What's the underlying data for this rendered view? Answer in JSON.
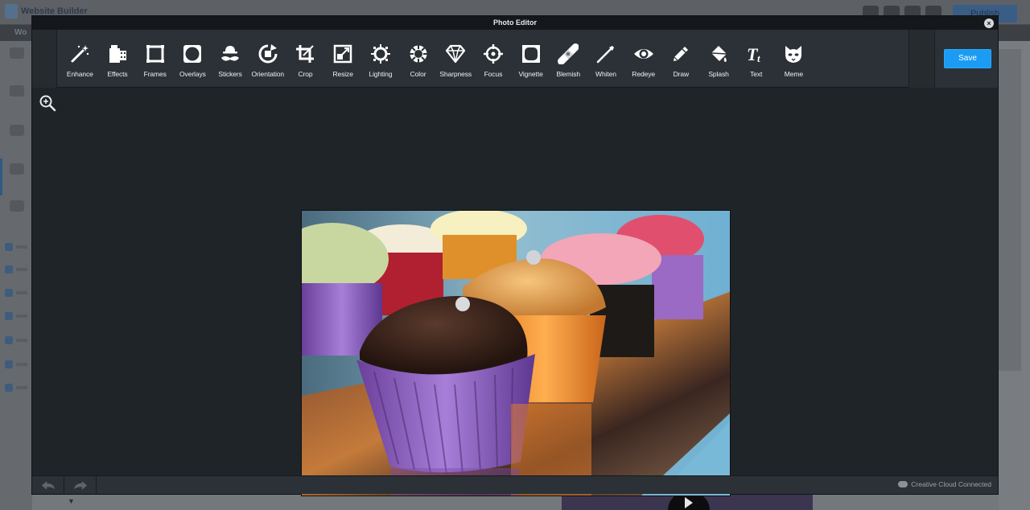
{
  "background": {
    "app_name": "Website Builder",
    "publish_label": "Publish",
    "subbar_label": "Wo"
  },
  "modal": {
    "title": "Photo Editor",
    "close_label": "×"
  },
  "toolbar": {
    "tools": [
      {
        "label": "Enhance",
        "icon": "magic-wand-icon"
      },
      {
        "label": "Effects",
        "icon": "film-effects-icon"
      },
      {
        "label": "Frames",
        "icon": "frame-icon"
      },
      {
        "label": "Overlays",
        "icon": "overlay-icon"
      },
      {
        "label": "Stickers",
        "icon": "mustache-hat-icon"
      },
      {
        "label": "Orientation",
        "icon": "rotate-icon"
      },
      {
        "label": "Crop",
        "icon": "crop-icon"
      },
      {
        "label": "Resize",
        "icon": "resize-icon"
      },
      {
        "label": "Lighting",
        "icon": "sun-icon"
      },
      {
        "label": "Color",
        "icon": "color-wheel-icon"
      },
      {
        "label": "Sharpness",
        "icon": "diamond-icon"
      },
      {
        "label": "Focus",
        "icon": "crosshair-icon"
      },
      {
        "label": "Vignette",
        "icon": "vignette-icon"
      },
      {
        "label": "Blemish",
        "icon": "bandage-icon"
      },
      {
        "label": "Whiten",
        "icon": "whiten-brush-icon"
      },
      {
        "label": "Redeye",
        "icon": "eye-icon"
      },
      {
        "label": "Draw",
        "icon": "pencil-icon"
      },
      {
        "label": "Splash",
        "icon": "paint-bucket-icon"
      },
      {
        "label": "Text",
        "icon": "text-icon"
      },
      {
        "label": "Meme",
        "icon": "cat-face-icon"
      }
    ],
    "save_label": "Save"
  },
  "canvas": {
    "image_subject": "cupcakes"
  },
  "footer": {
    "status_text": "Creative Cloud Connected"
  },
  "colors": {
    "accent": "#1b9cf2",
    "modal_bg": "#1f2428",
    "toolbar_bg": "#2b3136"
  }
}
